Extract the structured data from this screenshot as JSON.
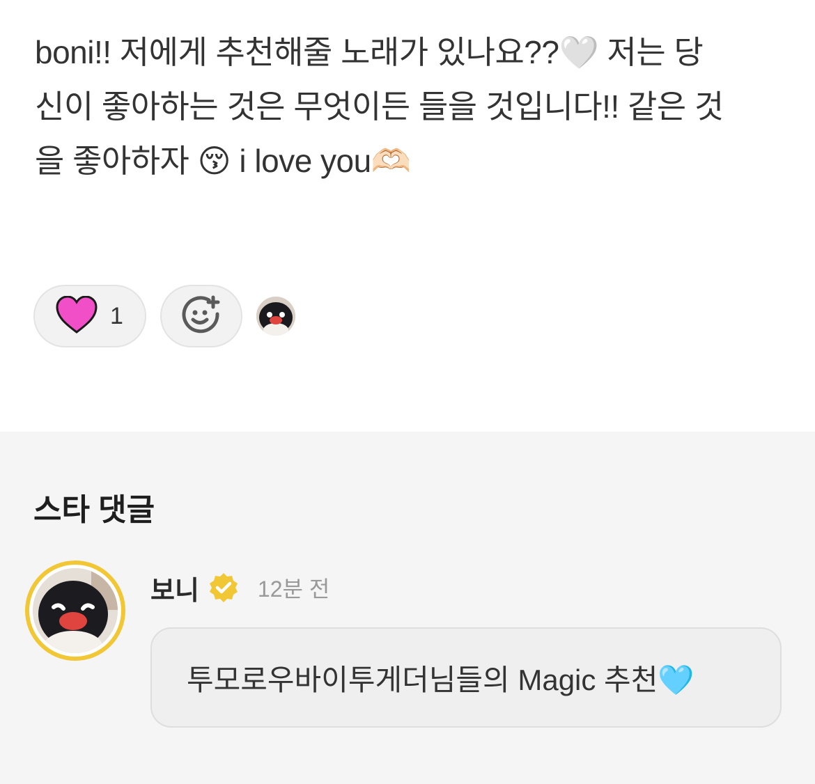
{
  "post": {
    "lines": [
      "boni!! 저에게 추천해줄 노래가 있나요??🤍 저는 당",
      "신이 좋아하는 것은 무엇이든 들을 것입니다!! 같은 것",
      "을 좋아하자 😚 i love you🫶🏻"
    ]
  },
  "reactions": {
    "like_count": "1",
    "like_icon": "pink-heart-icon",
    "add_icon": "add-reaction-icon"
  },
  "comments": {
    "section_title": "스타 댓글",
    "items": [
      {
        "author": "보니",
        "verified_icon": "verified-badge-icon",
        "time": "12분 전",
        "text": "투모로우바이투게더님들의 Magic 추천🩵"
      }
    ]
  },
  "colors": {
    "heart": "#f04fc8",
    "badge": "#f2c736",
    "background_comments": "#f5f5f5"
  }
}
